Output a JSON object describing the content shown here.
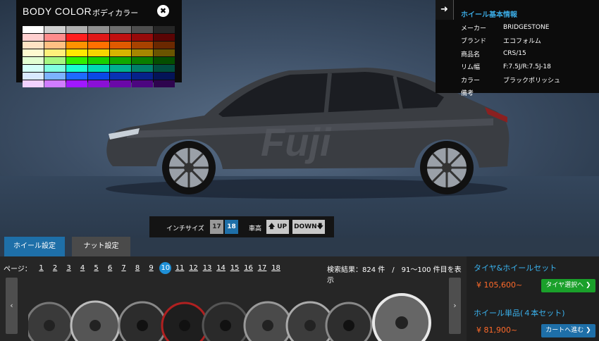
{
  "color_panel": {
    "title": "BODY COLOR",
    "subtitle": "ボディカラー",
    "close_glyph": "✖",
    "swatches": [
      [
        "#ffffff",
        "#d0d0d0",
        "#b0b0b0",
        "#909090",
        "#6e6e6e",
        "#4e4e4e",
        "#262626"
      ],
      [
        "#ffd0d0",
        "#ff8c8c",
        "#ff1e1e",
        "#e01818",
        "#c01010",
        "#960a0a",
        "#5a0404"
      ],
      [
        "#ffe2c4",
        "#ffc083",
        "#ff9200",
        "#ff7000",
        "#e05a00",
        "#a84200",
        "#6a2800"
      ],
      [
        "#fffad0",
        "#fff07a",
        "#ffe800",
        "#f6d400",
        "#d6b400",
        "#a68600",
        "#6a5400"
      ],
      [
        "#e2ffd2",
        "#a6f782",
        "#30f000",
        "#18d000",
        "#10a800",
        "#0a7e00",
        "#054e00"
      ],
      [
        "#d4fff8",
        "#80ffe2",
        "#18ffd0",
        "#00d8b4",
        "#00b090",
        "#00806a",
        "#004e40"
      ],
      [
        "#d8e8ff",
        "#7cb2ff",
        "#1e6aff",
        "#0a48e6",
        "#0832b4",
        "#06228a",
        "#041458"
      ],
      [
        "#f2d2ff",
        "#d07cff",
        "#a018ff",
        "#8a10d6",
        "#6a08a8",
        "#4c0680",
        "#2e044e"
      ]
    ]
  },
  "info_panel": {
    "arrow_glyph": "➜",
    "title": "ホイール基本情報",
    "rows": [
      {
        "label": "メーカー",
        "value": "BRIDGESTONE"
      },
      {
        "label": "ブランド",
        "value": "エコフォルム"
      },
      {
        "label": "商品名",
        "value": "CRS/15"
      },
      {
        "label": "リム幅",
        "value": "F:7.5J/R:7.5J-18"
      },
      {
        "label": "カラー",
        "value": "ブラックポリッシュ"
      },
      {
        "label": "備考",
        "value": ""
      }
    ]
  },
  "car": {
    "body_color": "#3a3d42",
    "decal_text": "Fuji"
  },
  "controls": {
    "inch_label": "インチサイズ",
    "inch_17": "17",
    "inch_18": "18",
    "height_label": "車高",
    "up_label": "🡅 UP",
    "down_label": "DOWN🡇"
  },
  "tabs": {
    "wheel": "ホイール設定",
    "nut": "ナット設定"
  },
  "pager": {
    "label": "ページ：",
    "pages": [
      "1",
      "2",
      "3",
      "4",
      "5",
      "6",
      "7",
      "8",
      "9",
      "10",
      "11",
      "12",
      "13",
      "14",
      "15",
      "16",
      "17",
      "18"
    ],
    "active": "10"
  },
  "results_text": "検索結果：824 件　/　91～100 件目を表示",
  "scroll_left": "‹",
  "scroll_right": "›",
  "buy": {
    "set_title": "タイヤ&ホイールセット",
    "set_price": "¥ 105,600~",
    "set_button": "タイヤ選択へ ❯",
    "single_title": "ホイール単品(４本セット)",
    "single_price": "¥ 81,900~",
    "single_button": "カートへ進む ❯"
  },
  "colors": {
    "accent_blue": "#1e6fa8",
    "price_orange": "#ff6a2a",
    "green_button": "#1aa02a"
  }
}
